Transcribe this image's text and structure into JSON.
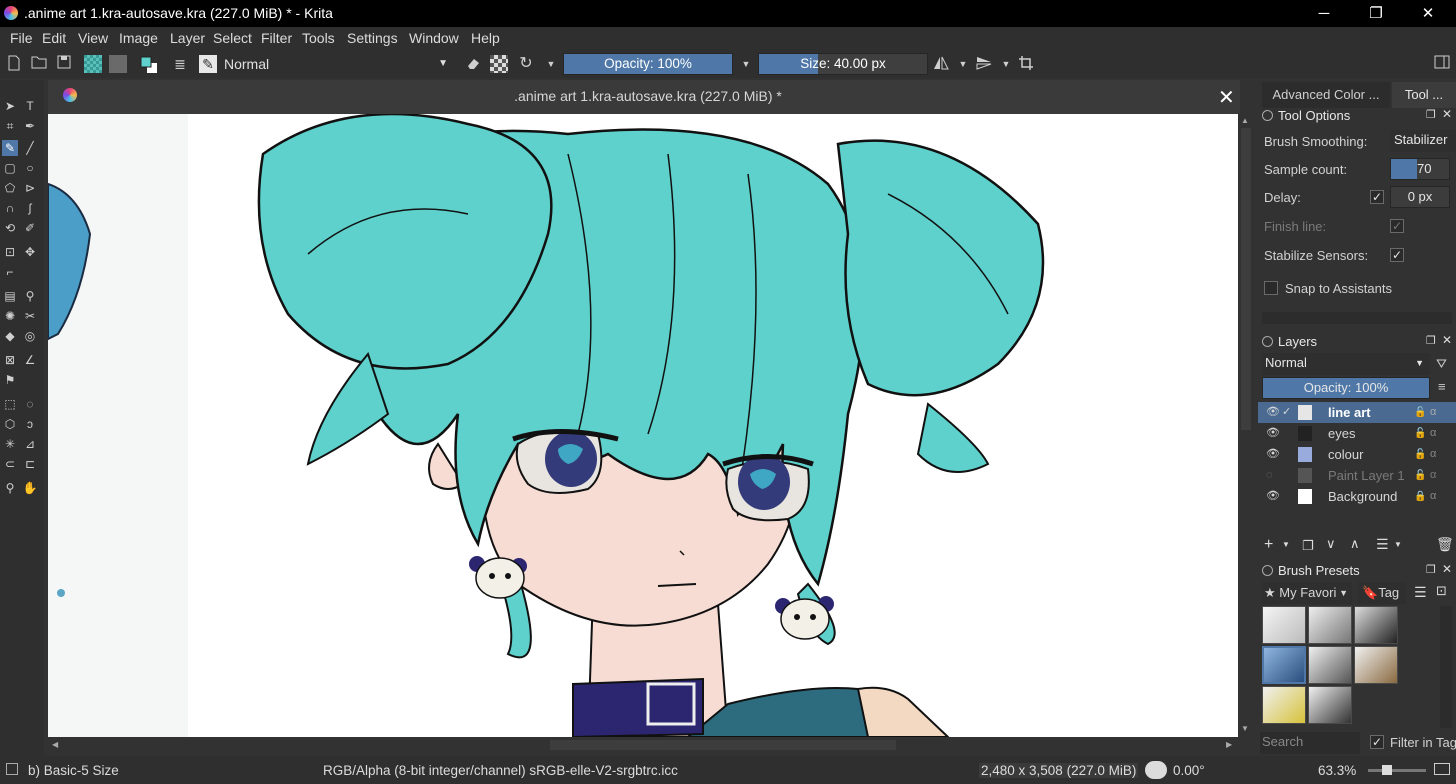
{
  "window": {
    "title": ".anime art 1.kra-autosave.kra (227.0 MiB) * - Krita",
    "minimize": "─",
    "restore": "❐",
    "close": "✕"
  },
  "menu": [
    "File",
    "Edit",
    "View",
    "Image",
    "Layer",
    "Select",
    "Filter",
    "Tools",
    "Settings",
    "Window",
    "Help"
  ],
  "toolbar": {
    "blend_mode": "Normal",
    "opacity_label": "Opacity: 100%",
    "opacity_value": 1.0,
    "size_label": "Size: 40.00 px",
    "size_fill": 0.35
  },
  "document": {
    "tab_title": ".anime art 1.kra-autosave.kra (227.0 MiB) *",
    "close": "✕"
  },
  "dock_tabs": [
    "Advanced Color ...",
    "Tool ..."
  ],
  "tool_options": {
    "title": "Tool Options",
    "brush_smoothing_label": "Brush Smoothing:",
    "brush_smoothing_value": "Stabilizer",
    "sample_count_label": "Sample count:",
    "sample_count_value": "70",
    "delay_label": "Delay:",
    "delay_value": "0 px",
    "finish_line_label": "Finish line:",
    "stabilize_sensors_label": "Stabilize Sensors:",
    "snap_label": "Snap to Assistants",
    "check": "✓"
  },
  "layers": {
    "title": "Layers",
    "blend_mode": "Normal",
    "opacity_label": "Opacity:  100%",
    "items": [
      {
        "name": "line art",
        "selected": true
      },
      {
        "name": "eyes",
        "selected": false
      },
      {
        "name": "colour",
        "selected": false
      },
      {
        "name": "Paint Layer 1",
        "selected": false,
        "hidden": true
      },
      {
        "name": "Background",
        "selected": false
      }
    ]
  },
  "brush_presets": {
    "title": "Brush Presets",
    "tag_combo": "My Favori",
    "tag_label": "Tag",
    "search_placeholder": "Search",
    "filter_label": "Filter in Tag"
  },
  "status": {
    "brush_name": "b) Basic-5 Size",
    "color_profile": "RGB/Alpha (8-bit integer/channel)  sRGB-elle-V2-srgbtrc.icc",
    "image_size": "2,480 x 3,508 (227.0 MiB)",
    "rotation": "0.00°",
    "zoom": "63.3%"
  },
  "colors": {
    "hair": "#5fd1cc",
    "skin": "#f7dcd4",
    "eye": "#333b7a",
    "selection": "#4a6a91",
    "accent": "#4f78a8"
  }
}
